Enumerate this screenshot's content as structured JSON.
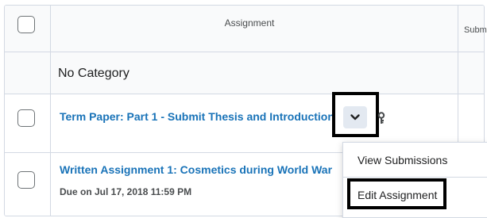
{
  "table": {
    "header": {
      "assignment_label": "Assignment",
      "next_column_label": "Subm"
    },
    "category": {
      "title": "No Category"
    },
    "assignments": [
      {
        "title": "Term Paper: Part 1 - Submit Thesis and Introduction"
      },
      {
        "title": "Written Assignment 1: Cosmetics during World War",
        "due": "Due on Jul 17, 2018 11:59 PM"
      }
    ]
  },
  "context_menu": {
    "items": [
      {
        "label": "View Submissions"
      },
      {
        "label": "Edit Assignment"
      }
    ]
  },
  "colors": {
    "link": "#1973b8",
    "border": "#d3d9e3",
    "highlight": "#000000"
  },
  "icons": {
    "dropdown": "chevron-down-icon",
    "key": "key-icon"
  }
}
